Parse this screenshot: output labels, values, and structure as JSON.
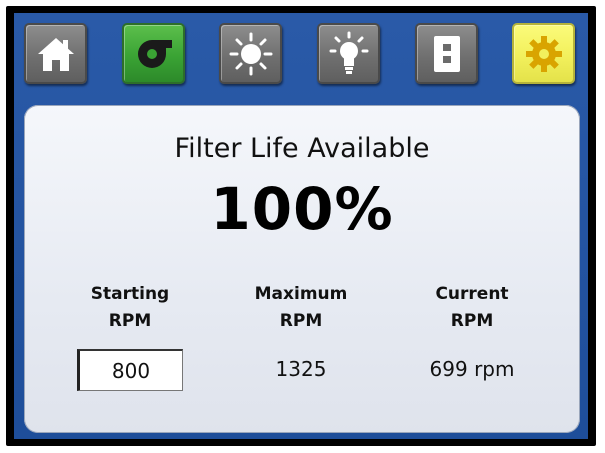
{
  "nav": {
    "buttons": [
      {
        "icon": "home-icon",
        "active": false
      },
      {
        "icon": "fan-icon",
        "active": true,
        "color": "#3aa334"
      },
      {
        "icon": "sun-icon",
        "active": false
      },
      {
        "icon": "light-bulb-icon",
        "active": false
      },
      {
        "icon": "switch-icon",
        "active": false
      },
      {
        "icon": "gear-icon",
        "active": true,
        "color": "#f2f05c"
      }
    ]
  },
  "panel": {
    "title": "Filter Life Available",
    "percent": "100%"
  },
  "columns": {
    "starting": {
      "line1": "Starting",
      "line2": "RPM",
      "value": "800"
    },
    "maximum": {
      "line1": "Maximum",
      "line2": "RPM",
      "value": "1325"
    },
    "current": {
      "line1": "Current",
      "line2": "RPM",
      "value": "699 rpm"
    }
  },
  "colors": {
    "screen_bg": "#2a5aa8",
    "panel_bg": "#eef1f6",
    "fan_active": "#3aa334",
    "settings_active": "#f2f05c"
  }
}
